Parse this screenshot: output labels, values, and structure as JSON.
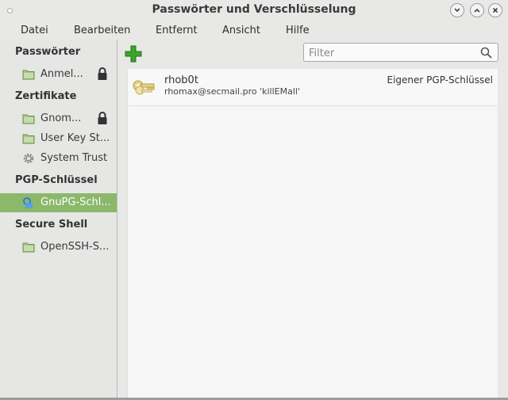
{
  "window": {
    "title": "Passwörter und Verschlüsselung",
    "controls": [
      "minimize",
      "maximize",
      "close"
    ]
  },
  "menu": {
    "items": [
      "Datei",
      "Bearbeiten",
      "Entfernt",
      "Ansicht",
      "Hilfe"
    ]
  },
  "sidebar": {
    "sections": [
      {
        "title": "Passwörter",
        "items": [
          {
            "label": "Anmel...",
            "icon": "folder-icon",
            "locked": true
          }
        ]
      },
      {
        "title": "Zertifikate",
        "items": [
          {
            "label": "Gnom...",
            "icon": "folder-icon",
            "locked": true
          },
          {
            "label": "User Key St...",
            "icon": "folder-icon",
            "locked": false
          },
          {
            "label": "System Trust",
            "icon": "gear-icon",
            "locked": false
          }
        ]
      },
      {
        "title": "PGP-Schlüssel",
        "items": [
          {
            "label": "GnuPG-Schl...",
            "icon": "keyring-icon",
            "locked": false,
            "selected": true
          }
        ]
      },
      {
        "title": "Secure Shell",
        "items": [
          {
            "label": "OpenSSH-S...",
            "icon": "folder-icon",
            "locked": false
          }
        ]
      }
    ]
  },
  "toolbar": {
    "add_icon": "plus-icon",
    "filter_placeholder": "Filter"
  },
  "keys": [
    {
      "name": "rhob0t",
      "description": "rhomax@secmail.pro 'killEMall'",
      "type": "Eigener PGP-Schlüssel"
    }
  ],
  "colors": {
    "selection": "#8bb86a",
    "add_green": "#3aa52b"
  }
}
